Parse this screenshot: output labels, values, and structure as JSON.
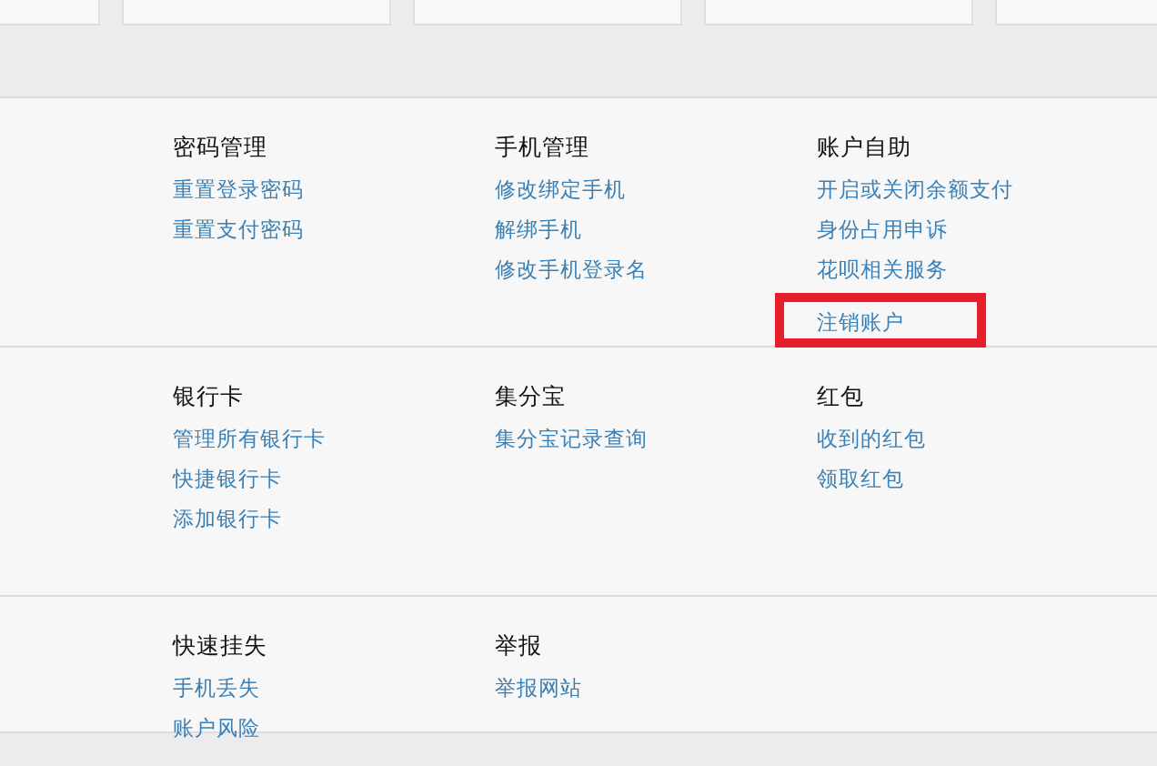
{
  "sections": [
    {
      "groups": [
        {
          "title": "密码管理",
          "links": [
            {
              "label": "重置登录密码",
              "highlighted": false
            },
            {
              "label": "重置支付密码",
              "highlighted": false
            }
          ]
        },
        {
          "title": "手机管理",
          "links": [
            {
              "label": "修改绑定手机",
              "highlighted": false
            },
            {
              "label": "解绑手机",
              "highlighted": false
            },
            {
              "label": "修改手机登录名",
              "highlighted": false
            }
          ]
        },
        {
          "title": "账户自助",
          "links": [
            {
              "label": "开启或关闭余额支付",
              "highlighted": false
            },
            {
              "label": "身份占用申诉",
              "highlighted": false
            },
            {
              "label": "花呗相关服务",
              "highlighted": false
            },
            {
              "label": "注销账户",
              "highlighted": true
            }
          ]
        }
      ]
    },
    {
      "groups": [
        {
          "title": "银行卡",
          "links": [
            {
              "label": "管理所有银行卡",
              "highlighted": false
            },
            {
              "label": "快捷银行卡",
              "highlighted": false
            },
            {
              "label": "添加银行卡",
              "highlighted": false
            }
          ]
        },
        {
          "title": "集分宝",
          "links": [
            {
              "label": "集分宝记录查询",
              "highlighted": false
            }
          ]
        },
        {
          "title": "红包",
          "links": [
            {
              "label": "收到的红包",
              "highlighted": false
            },
            {
              "label": "领取红包",
              "highlighted": false
            }
          ]
        }
      ]
    },
    {
      "groups": [
        {
          "title": "快速挂失",
          "links": [
            {
              "label": "手机丢失",
              "highlighted": false
            },
            {
              "label": "账户风险",
              "highlighted": false
            }
          ]
        },
        {
          "title": "举报",
          "links": [
            {
              "label": "举报网站",
              "highlighted": false
            }
          ]
        }
      ]
    }
  ]
}
